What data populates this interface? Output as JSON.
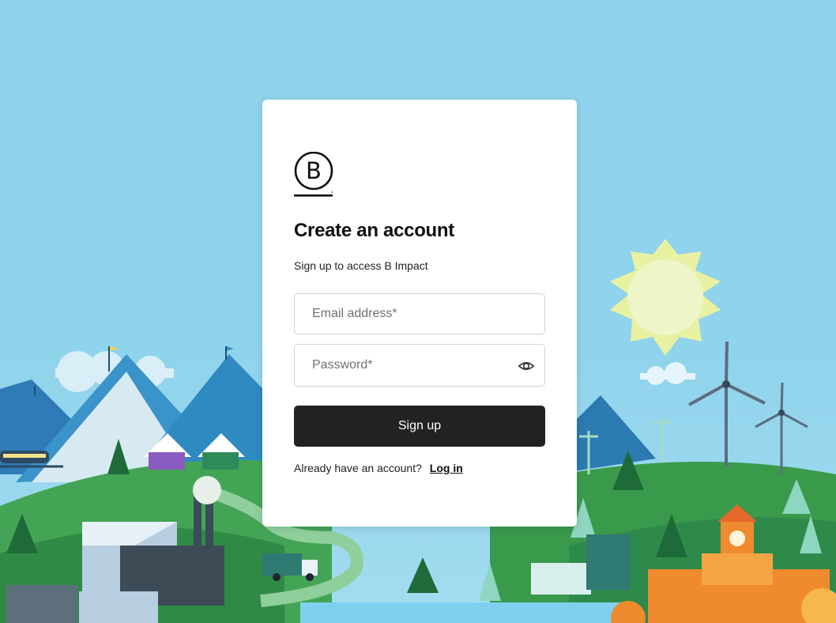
{
  "brand": {
    "logo_icon": "b-corp-logo-icon"
  },
  "form": {
    "title": "Create an account",
    "subtitle": "Sign up to access B Impact",
    "email_placeholder": "Email address*",
    "password_placeholder": "Password*",
    "password_toggle_icon": "eye-icon",
    "submit_label": "Sign up",
    "login_prompt": "Already have an account?",
    "login_link": "Log in"
  },
  "colors": {
    "sky": "#8fd3ec",
    "button": "#222222",
    "hill_green": "#3f9f4f",
    "sun": "#eef3a6"
  }
}
